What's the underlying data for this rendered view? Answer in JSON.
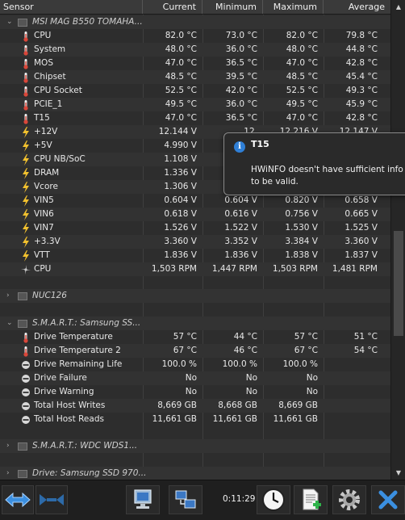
{
  "header": {
    "sensor": "Sensor",
    "current": "Current",
    "minimum": "Minimum",
    "maximum": "Maximum",
    "average": "Average"
  },
  "groups": {
    "msi": "MSI MAG B550 TOMAHA...",
    "nuc": "NUC126",
    "smart_samsung": "S.M.A.R.T.: Samsung SS...",
    "smart_wdc": "S.M.A.R.T.: WDC WDS1...",
    "drive_samsung": "Drive: Samsung SSD 970..."
  },
  "rows": [
    {
      "label": "CPU",
      "current": "82.0 °C",
      "minimum": "73.0 °C",
      "maximum": "82.0 °C",
      "average": "79.8 °C",
      "icon": "thermometer-icon"
    },
    {
      "label": "System",
      "current": "48.0 °C",
      "minimum": "36.0 °C",
      "maximum": "48.0 °C",
      "average": "44.8 °C",
      "icon": "thermometer-icon"
    },
    {
      "label": "MOS",
      "current": "47.0 °C",
      "minimum": "36.5 °C",
      "maximum": "47.0 °C",
      "average": "42.8 °C",
      "icon": "thermometer-icon"
    },
    {
      "label": "Chipset",
      "current": "48.5 °C",
      "minimum": "39.5 °C",
      "maximum": "48.5 °C",
      "average": "45.4 °C",
      "icon": "thermometer-icon"
    },
    {
      "label": "CPU Socket",
      "current": "52.5 °C",
      "minimum": "42.0 °C",
      "maximum": "52.5 °C",
      "average": "49.3 °C",
      "icon": "thermometer-icon"
    },
    {
      "label": "PCIE_1",
      "current": "49.5 °C",
      "minimum": "36.0 °C",
      "maximum": "49.5 °C",
      "average": "45.9 °C",
      "icon": "thermometer-icon"
    },
    {
      "label": "T15",
      "current": "47.0 °C",
      "minimum": "36.5 °C",
      "maximum": "47.0 °C",
      "average": "42.8 °C",
      "icon": "thermometer-icon"
    },
    {
      "label": "+12V",
      "current": "12.144 V",
      "minimum": "12.",
      "maximum": "12.216 V",
      "average": "12.147 V",
      "icon": "lightning-icon"
    },
    {
      "label": "+5V",
      "current": "4.990 V",
      "minimum": "",
      "maximum": "",
      "average": "",
      "icon": "lightning-icon"
    },
    {
      "label": "CPU NB/SoC",
      "current": "1.108 V",
      "minimum": "",
      "maximum": "",
      "average": "",
      "icon": "lightning-icon"
    },
    {
      "label": "DRAM",
      "current": "1.336 V",
      "minimum": "",
      "maximum": "",
      "average": "",
      "icon": "lightning-icon"
    },
    {
      "label": "Vcore",
      "current": "1.306 V",
      "minimum": "",
      "maximum": "",
      "average": "",
      "icon": "lightning-icon"
    },
    {
      "label": "VIN5",
      "current": "0.604 V",
      "minimum": "0.604 V",
      "maximum": "0.820 V",
      "average": "0.658 V",
      "icon": "lightning-icon"
    },
    {
      "label": "VIN6",
      "current": "0.618 V",
      "minimum": "0.616 V",
      "maximum": "0.756 V",
      "average": "0.665 V",
      "icon": "lightning-icon"
    },
    {
      "label": "VIN7",
      "current": "1.526 V",
      "minimum": "1.522 V",
      "maximum": "1.530 V",
      "average": "1.525 V",
      "icon": "lightning-icon"
    },
    {
      "label": "+3.3V",
      "current": "3.360 V",
      "minimum": "3.352 V",
      "maximum": "3.384 V",
      "average": "3.360 V",
      "icon": "lightning-icon"
    },
    {
      "label": "VTT",
      "current": "1.836 V",
      "minimum": "1.836 V",
      "maximum": "1.838 V",
      "average": "1.837 V",
      "icon": "lightning-icon"
    },
    {
      "label": "CPU",
      "current": "1,503 RPM",
      "minimum": "1,447 RPM",
      "maximum": "1,503 RPM",
      "average": "1,481 RPM",
      "icon": "fan-icon"
    }
  ],
  "smart_rows": [
    {
      "label": "Drive Temperature",
      "current": "57 °C",
      "minimum": "44 °C",
      "maximum": "57 °C",
      "average": "51 °C",
      "icon": "thermometer-icon"
    },
    {
      "label": "Drive Temperature 2",
      "current": "67 °C",
      "minimum": "46 °C",
      "maximum": "67 °C",
      "average": "54 °C",
      "icon": "thermometer-icon"
    },
    {
      "label": "Drive Remaining Life",
      "current": "100.0 %",
      "minimum": "100.0 %",
      "maximum": "100.0 %",
      "average": "",
      "icon": "disk-icon"
    },
    {
      "label": "Drive Failure",
      "current": "No",
      "minimum": "No",
      "maximum": "No",
      "average": "",
      "icon": "disk-icon"
    },
    {
      "label": "Drive Warning",
      "current": "No",
      "minimum": "No",
      "maximum": "No",
      "average": "",
      "icon": "disk-icon"
    },
    {
      "label": "Total Host Writes",
      "current": "8,669 GB",
      "minimum": "8,668 GB",
      "maximum": "8,669 GB",
      "average": "",
      "icon": "disk-icon"
    },
    {
      "label": "Total Host Reads",
      "current": "11,661 GB",
      "minimum": "11,661 GB",
      "maximum": "11,661 GB",
      "average": "",
      "icon": "disk-icon"
    }
  ],
  "tooltip": {
    "title": "T15",
    "line1": "HWiNFO doesn't have sufficient info",
    "line2": "to be valid."
  },
  "toolbar": {
    "elapsed_time": "0:11:29"
  },
  "colors": {
    "accent_blue": "#2f7fd6",
    "thermo_red": "#d9473a",
    "bolt_yellow": "#f2c12e"
  }
}
